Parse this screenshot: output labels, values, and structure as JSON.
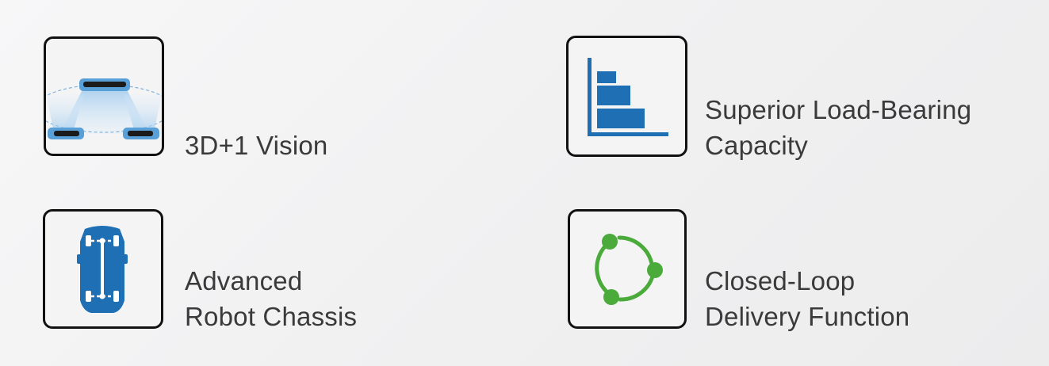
{
  "features": [
    {
      "id": "vision",
      "lines": [
        "3D+1 Vision"
      ],
      "icon": "camera-vision-icon"
    },
    {
      "id": "load",
      "lines": [
        "Superior Load-Bearing",
        "Capacity"
      ],
      "icon": "load-bars-icon"
    },
    {
      "id": "chassis",
      "lines": [
        "Advanced",
        "Robot Chassis"
      ],
      "icon": "robot-chassis-icon"
    },
    {
      "id": "loop",
      "lines": [
        "Closed-Loop",
        "Delivery Function"
      ],
      "icon": "closed-loop-icon"
    }
  ],
  "colors": {
    "blue": "#1f6fb5",
    "light_blue": "#bcd9f0",
    "green": "#4aab3b",
    "text": "#3a3a3a",
    "border": "#111111"
  }
}
